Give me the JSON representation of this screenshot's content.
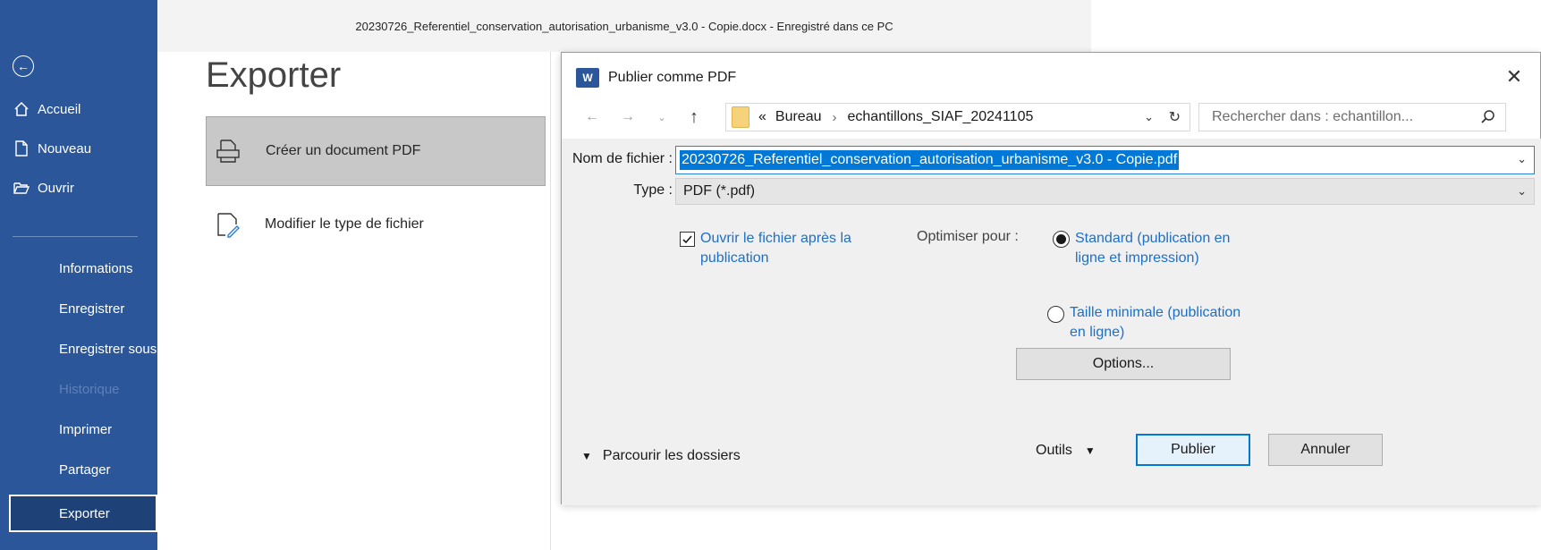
{
  "window": {
    "title": "20230726_Referentiel_conservation_autorisation_urbanisme_v3.0 - Copie.docx  -  Enregistré dans ce PC"
  },
  "sidebar": {
    "items": [
      {
        "label": "Accueil",
        "icon": "home-icon"
      },
      {
        "label": "Nouveau",
        "icon": "new-document-icon"
      },
      {
        "label": "Ouvrir",
        "icon": "folder-open-icon"
      },
      {
        "label": "Informations"
      },
      {
        "label": "Enregistrer"
      },
      {
        "label": "Enregistrer sous"
      },
      {
        "label": "Historique",
        "disabled": true
      },
      {
        "label": "Imprimer"
      },
      {
        "label": "Partager"
      },
      {
        "label": "Exporter",
        "active": true
      }
    ]
  },
  "main": {
    "heading": "Exporter",
    "options": [
      {
        "label": "Créer un document PDF",
        "icon": "pdf-document-icon",
        "selected": true
      },
      {
        "label": "Modifier le type de fichier",
        "icon": "change-file-type-icon"
      }
    ]
  },
  "dialog": {
    "title": "Publier comme PDF",
    "app_icon_text": "W",
    "path": {
      "prefix": "«",
      "segments": [
        "Bureau",
        "echantillons_SIAF_20241105"
      ]
    },
    "search_placeholder": "Rechercher dans : echantillon...",
    "filename_label": "Nom de fichier :",
    "filename_value": "20230726_Referentiel_conservation_autorisation_urbanisme_v3.0 - Copie.pdf",
    "type_label": "Type :",
    "type_value": "PDF (*.pdf)",
    "open_after_label": "Ouvrir le fichier après la publication",
    "open_after_checked": true,
    "optimize_label": "Optimiser pour :",
    "radio_standard_label": "Standard (publication en ligne et impression)",
    "radio_minimal_label": "Taille minimale (publication en ligne)",
    "radio_selected": "standard",
    "options_button": "Options...",
    "browse_label": "Parcourir les dossiers",
    "tools_label": "Outils",
    "publish_button": "Publier",
    "cancel_button": "Annuler"
  },
  "colors": {
    "sidebar": "#2b579a",
    "accent": "#0078d7",
    "link": "#1e6fc7"
  }
}
